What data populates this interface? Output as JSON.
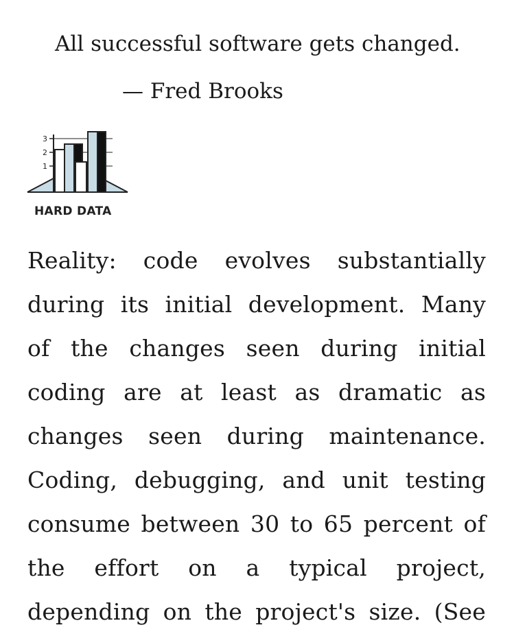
{
  "epigraph": {
    "quote": "All successful software gets changed.",
    "attribution": "— Fred Brooks"
  },
  "hard_data_icon": {
    "caption": "HARD DATA",
    "tick_labels": [
      "3",
      "2",
      "1"
    ]
  },
  "body": {
    "lines": [
      "Reality: code evolves substantially",
      "during its initial development. Many",
      "of the changes seen during initial",
      "coding are at least as dramatic as",
      "changes seen during maintenance.",
      "Coding, debugging, and unit testing",
      "consume between 30 to 65 percent of",
      "the effort on a typical project,",
      "depending on the project's size. (See"
    ]
  }
}
